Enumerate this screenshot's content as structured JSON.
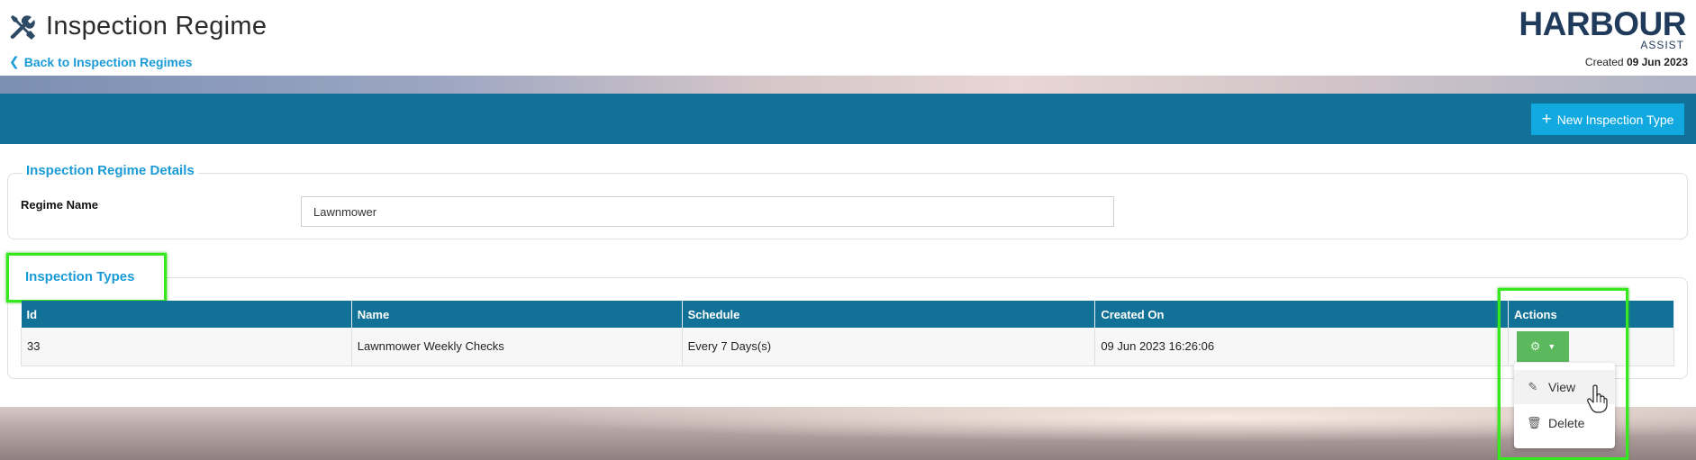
{
  "header": {
    "title": "Inspection Regime",
    "title_icon": "tools-icon",
    "back_link": "Back to Inspection Regimes",
    "logo_main": "HARBOUR",
    "logo_sub": "ASSIST",
    "created_label": "Created",
    "created_date": "09 Jun 2023"
  },
  "toolbar": {
    "new_button": "New Inspection Type"
  },
  "details": {
    "legend": "Inspection Regime Details",
    "regime_name_label": "Regime Name",
    "regime_name_value": "Lawnmower"
  },
  "types": {
    "legend": "Inspection Types",
    "columns": [
      "Id",
      "Name",
      "Schedule",
      "Created On",
      "Actions"
    ],
    "rows": [
      {
        "id": "33",
        "name": "Lawnmower Weekly Checks",
        "schedule": "Every 7 Days(s)",
        "created_on": "09 Jun 2023 16:26:06"
      }
    ]
  },
  "actions_menu": {
    "items": [
      {
        "label": "View",
        "icon": "pencil-icon"
      },
      {
        "label": "Delete",
        "icon": "trash-icon"
      }
    ]
  },
  "colors": {
    "toolbar": "#117196",
    "accent": "#1a9bd7",
    "new_button": "#12a9e0",
    "actions_button": "#5cb85c",
    "highlight": "#37e81f"
  }
}
